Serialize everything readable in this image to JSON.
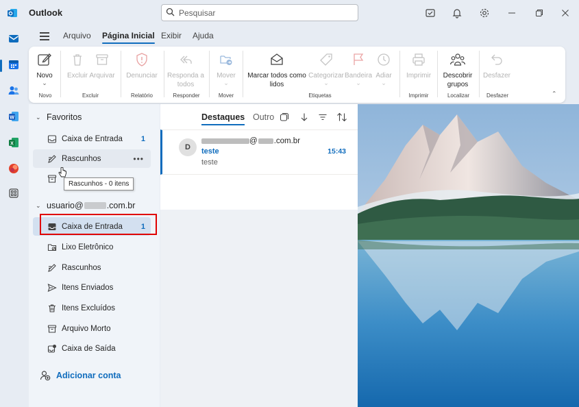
{
  "app": {
    "title": "Outlook"
  },
  "search": {
    "placeholder": "Pesquisar"
  },
  "tabs": [
    {
      "label": "Arquivo"
    },
    {
      "label": "Página Inicial"
    },
    {
      "label": "Exibir"
    },
    {
      "label": "Ajuda"
    }
  ],
  "ribbon": {
    "novo": "Novo",
    "excluir": "Excluir",
    "arquivar": "Arquivar",
    "denunciar": "Denunciar",
    "responda_todos_1": "Responda a",
    "responda_todos_2": "todos",
    "mover": "Mover",
    "marcar_1": "Marcar todos como",
    "marcar_2": "lidos",
    "categorizar": "Categorizar",
    "bandeira": "Bandeira",
    "adiar": "Adiar",
    "imprimir": "Imprimir",
    "descobrir_1": "Descobrir",
    "descobrir_2": "grupos",
    "desfazer": "Desfazer",
    "groups": {
      "novo": "Novo",
      "excluir": "Excluir",
      "relatorio": "Relatório",
      "responder": "Responder",
      "mover": "Mover",
      "etiquetas": "Etiquetas",
      "imprimir": "Imprimir",
      "localizar": "Localizar",
      "desfazer": "Desfazer"
    }
  },
  "favorites": {
    "header": "Favoritos",
    "items": [
      {
        "label": "Caixa de Entrada",
        "count": "1"
      },
      {
        "label": "Rascunhos"
      }
    ]
  },
  "tooltip": "Rascunhos - 0 itens",
  "account": {
    "header_prefix": "usuario@",
    "header_suffix": ".com.br",
    "items": [
      {
        "label": "Caixa de Entrada",
        "count": "1"
      },
      {
        "label": "Lixo Eletrônico"
      },
      {
        "label": "Rascunhos"
      },
      {
        "label": "Itens Enviados"
      },
      {
        "label": "Itens Excluídos"
      },
      {
        "label": "Arquivo Morto"
      },
      {
        "label": "Caixa de Saída"
      }
    ]
  },
  "add_account": "Adicionar conta",
  "message_list": {
    "tab_focused": "Destaques",
    "tab_other": "Outro",
    "messages": [
      {
        "avatar": "D",
        "sender_at": "@",
        "sender_suffix": ".com.br",
        "subject": "teste",
        "time": "15:43",
        "preview": "teste"
      }
    ]
  },
  "colors": {
    "accent": "#0f6cbd",
    "highlight": "#e00000"
  }
}
